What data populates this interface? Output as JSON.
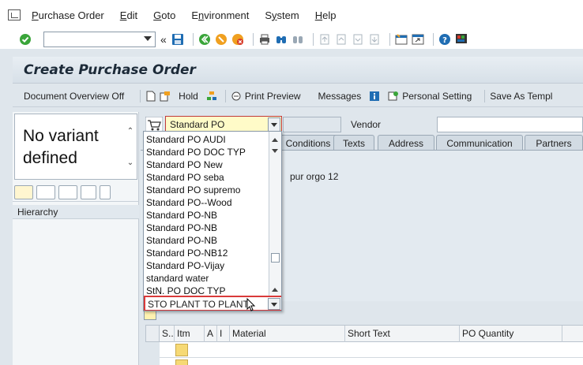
{
  "menu": {
    "items": [
      {
        "label": "Purchase Order",
        "u": "P"
      },
      {
        "label": "Edit",
        "u": "E"
      },
      {
        "label": "Goto",
        "u": "G"
      },
      {
        "label": "Environment",
        "u": "n"
      },
      {
        "label": "System",
        "u": "y"
      },
      {
        "label": "Help",
        "u": "H"
      }
    ]
  },
  "toolbar": {
    "command_value": "",
    "colors": {
      "green": "#3aa53a",
      "blue": "#1f6db3",
      "orange": "#f0a020",
      "red": "#d63a2a"
    }
  },
  "title": "Create Purchase Order",
  "app_toolbar": {
    "doc_overview": "Document Overview Off",
    "hold": "Hold",
    "print_preview": "Print Preview",
    "messages": "Messages",
    "personal_setting": "Personal Setting",
    "save_as_template": "Save As Templ"
  },
  "left_panel": {
    "variant_text": "No variant defined",
    "hierarchy_label": "Hierarchy"
  },
  "header": {
    "po_type_value": "Standard PO",
    "vendor_label": "Vendor",
    "vendor_value": ""
  },
  "tabs": [
    "Conditions",
    "Texts",
    "Address",
    "Communication",
    "Partners"
  ],
  "tab_content": {
    "purchasing_org": "pur orgo 12"
  },
  "dropdown": {
    "options": [
      "Standard PO AUDI",
      "Standard PO DOC TYP",
      "Standard PO New",
      "Standard PO seba",
      "Standard PO supremo",
      "Standard PO--Wood",
      "Standard PO-NB",
      "Standard PO-NB",
      "Standard PO-NB",
      "Standard PO-NB12",
      "Standard PO-Vijay",
      "standard water",
      "StN. PO DOC TYP"
    ],
    "highlighted": "STO PLANT TO PLANT"
  },
  "item_grid": {
    "columns": [
      "S..",
      "Itm",
      "A",
      "I",
      "Material",
      "Short Text",
      "PO Quantity"
    ]
  }
}
